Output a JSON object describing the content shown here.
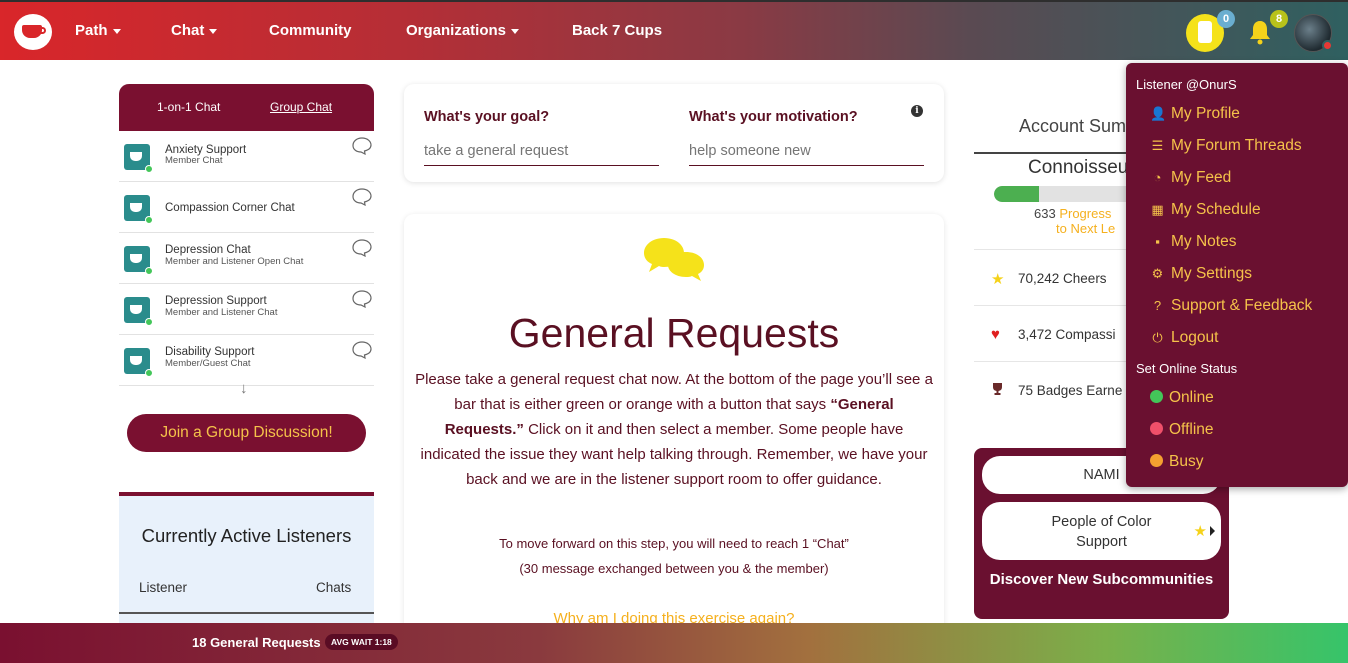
{
  "nav": {
    "items": [
      {
        "label": "Path",
        "has_caret": true
      },
      {
        "label": "Chat",
        "has_caret": true
      },
      {
        "label": "Community",
        "has_caret": false
      },
      {
        "label": "Organizations",
        "has_caret": true
      },
      {
        "label": "Back 7 Cups",
        "has_caret": false
      }
    ],
    "jar_count": "0",
    "notifications_count": "8",
    "icons": [
      "cup-logo-icon",
      "jar-icon",
      "bell-icon",
      "avatar"
    ]
  },
  "chat_panel": {
    "tabs": [
      "1-on-1 Chat",
      "Group Chat"
    ],
    "active_tab": "Group Chat",
    "rooms": [
      {
        "name": "Anxiety Support",
        "sub": "Member Chat"
      },
      {
        "name": "Compassion Corner Chat",
        "sub": ""
      },
      {
        "name": "Depression Chat",
        "sub": "Member and Listener Open Chat"
      },
      {
        "name": "Depression Support",
        "sub": "Member and Listener Chat"
      },
      {
        "name": "Disability Support",
        "sub": "Member/Guest Chat"
      }
    ],
    "more_arrow": "↓",
    "join_button": "Join a Group Discussion!"
  },
  "active_listeners": {
    "title": "Currently Active Listeners",
    "col_listener": "Listener",
    "col_chats": "Chats"
  },
  "goal": {
    "goal_label": "What's your goal?",
    "goal_value": "take a general request",
    "motivation_label": "What's your motivation?",
    "motivation_value": "help someone new",
    "info_icon": "i"
  },
  "request": {
    "title": "General Requests",
    "body_1": "Please take a general request chat now. At the bottom of the page you’ll see a bar that is either green or orange with a button that says ",
    "body_bold": "“General Requests.”",
    "body_2": " Click on it and then select a member. Some people have indicated the issue they want help talking through. Remember, we have your back and we are in the listener support room to offer guidance.",
    "note_1": "To move forward on this step, you will need to reach 1 “Chat”",
    "note_2": "(30 message exchanged between you & the member)",
    "link": "Why am I doing this exercise again?"
  },
  "account": {
    "title": "Account Sum",
    "level": "Connoisseu",
    "progress_fraction": 0.32,
    "progress_points": "633",
    "progress_label_1": "Progress",
    "progress_label_2": "to Next Le",
    "stats": [
      {
        "icon": "star-icon",
        "text": "70,242 Cheers",
        "color": "#f5d21a"
      },
      {
        "icon": "heart-icon",
        "text": "3,472 Compassi",
        "color": "#e02020"
      },
      {
        "icon": "trophy-icon",
        "text": "75 Badges Earne",
        "color": "#6a2a2a"
      }
    ]
  },
  "subcommunities": {
    "items": [
      "NAMI",
      "People of Color Support"
    ],
    "discover": "Discover New Subcommunities"
  },
  "user_menu": {
    "header": "Listener @OnurS",
    "items": [
      {
        "label": "My Profile",
        "icon": "user-icon"
      },
      {
        "label": "My Forum Threads",
        "icon": "list-icon"
      },
      {
        "label": "My Feed",
        "icon": "rss-icon"
      },
      {
        "label": "My Schedule",
        "icon": "calendar-icon"
      },
      {
        "label": "My Notes",
        "icon": "note-icon"
      },
      {
        "label": "My Settings",
        "icon": "gear-icon"
      },
      {
        "label": "Support & Feedback",
        "icon": "question-icon"
      },
      {
        "label": "Logout",
        "icon": "power-icon"
      }
    ],
    "status_header": "Set Online Status",
    "statuses": [
      {
        "label": "Online",
        "color": "#43c659"
      },
      {
        "label": "Offline",
        "color": "#f0506a"
      },
      {
        "label": "Busy",
        "color": "#f5a030"
      }
    ]
  },
  "bottom_bar": {
    "text": "18 General Requests",
    "avg_wait": "AVG WAIT 1:18"
  },
  "colors": {
    "brand_maroon": "#7a1030",
    "accent_yellow": "#f5c24a",
    "nav_red": "#d9262a",
    "nav_teal": "#2f6060"
  }
}
